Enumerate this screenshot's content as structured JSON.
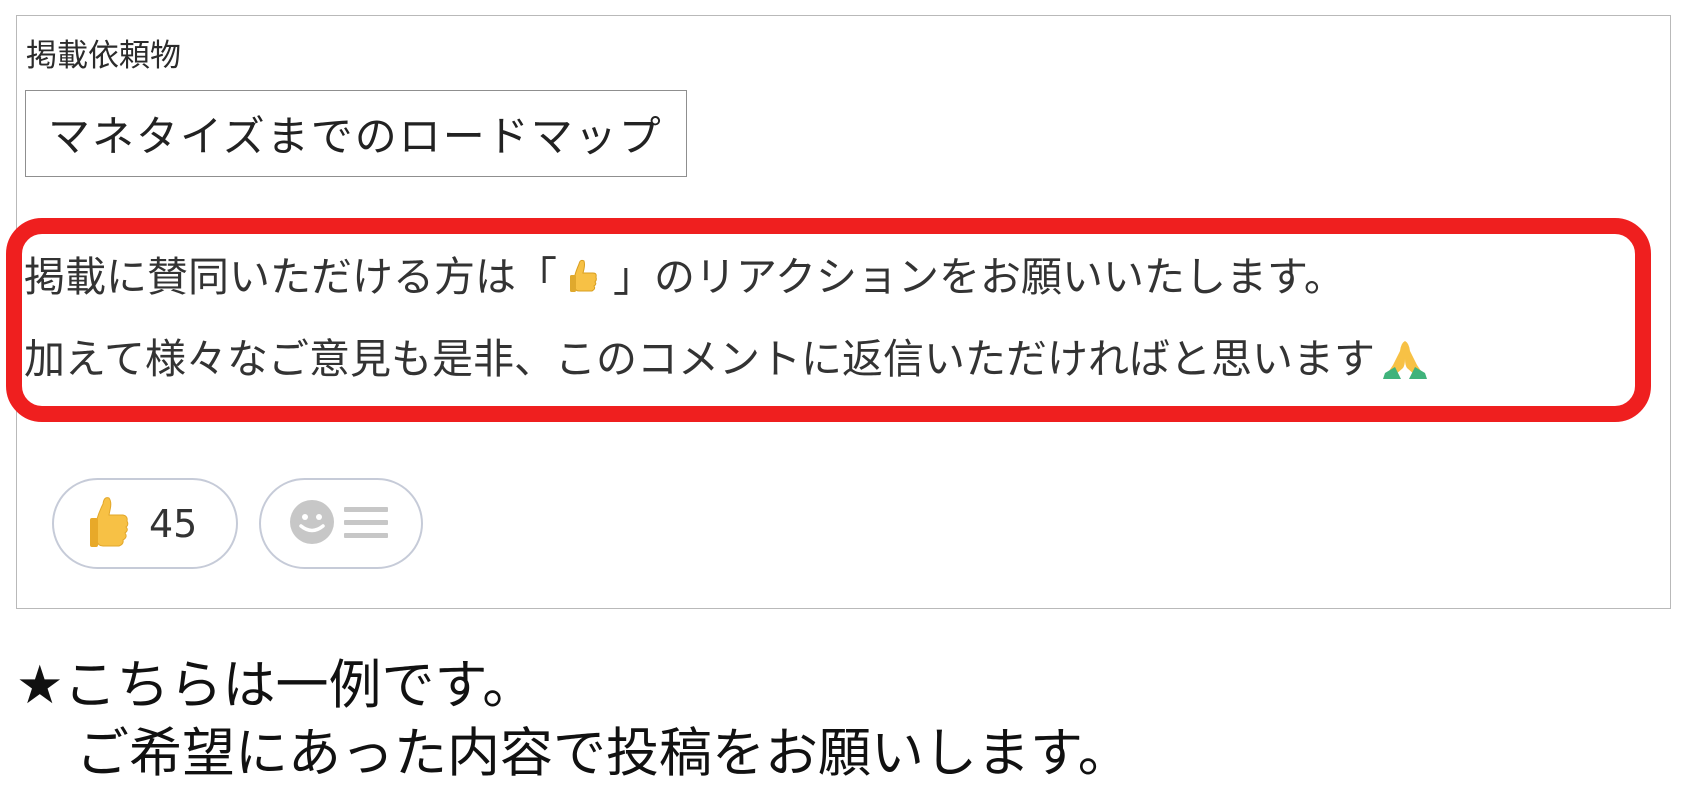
{
  "post": {
    "section_label": "掲載依頼物",
    "title_value": "マネタイズまでのロードマップ",
    "message": {
      "line1_before": "掲載に賛同いただける方は「",
      "line1_icon": "thumbs-up-icon",
      "line1_after": "」のリアクションをお願いいたします。",
      "line2": "加えて様々なご意見も是非、このコメントに返信いただければと思います",
      "line2_icon": "folded-hands-icon"
    },
    "reactions": [
      {
        "icon": "thumbs-up-icon",
        "count": "45"
      },
      {
        "icon": "add-reaction-icon"
      }
    ]
  },
  "footer_note": {
    "line1": "★こちらは一例です。",
    "line2": "ご希望にあった内容で投稿をお願いします。"
  },
  "colors": {
    "highlight_border": "#ef1f1f",
    "pill_border": "#c6cbd8",
    "thumb_yellow": "#f7c145",
    "hands_green": "#3fb37b",
    "hands_yellow": "#f7c145",
    "smiley_gray": "#c7c7c7"
  }
}
